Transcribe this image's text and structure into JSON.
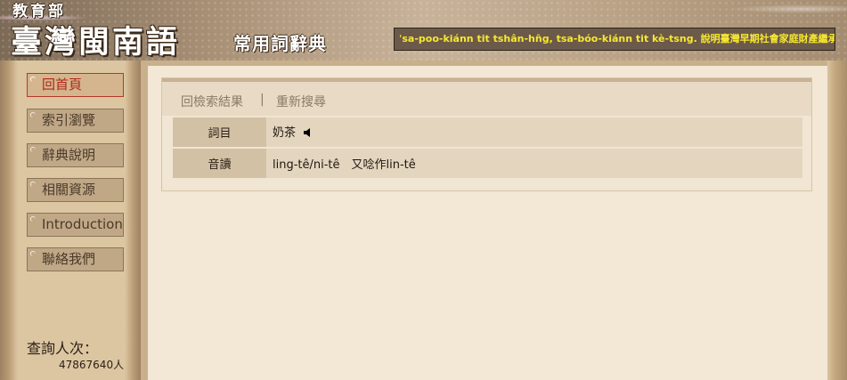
{
  "header": {
    "org": "教育部",
    "title": "臺灣閩南語",
    "subtitle": "常用詞辭典",
    "marquee": "ˈsa-poo-kiánn tit tshân-hn̂g, tsa-bóo-kiánn tit kè-tsng. 說明臺灣早期社會家庭財產繼承"
  },
  "sidebar": {
    "items": [
      {
        "label": "回首頁",
        "active": true
      },
      {
        "label": "索引瀏覽",
        "active": false
      },
      {
        "label": "辭典說明",
        "active": false
      },
      {
        "label": "相關資源",
        "active": false
      },
      {
        "label": "Introduction",
        "active": false
      },
      {
        "label": "聯絡我們",
        "active": false
      }
    ],
    "counter_label": "查詢人次：",
    "counter_value": "47867640人"
  },
  "panel": {
    "back_link": "回檢索結果",
    "separator": "|",
    "new_search": "重新搜尋",
    "rows": [
      {
        "key": "詞目",
        "value": "奶茶",
        "has_audio": true,
        "audio_icon": "speaker-icon"
      },
      {
        "key": "音讀",
        "value": "ling-tê/ni-tê　又唸作lin-tê",
        "has_audio": false
      }
    ]
  },
  "colors": {
    "marquee_text": "#f6e830",
    "active_item": "#b0281a",
    "content_bg": "#f3e7d5"
  }
}
